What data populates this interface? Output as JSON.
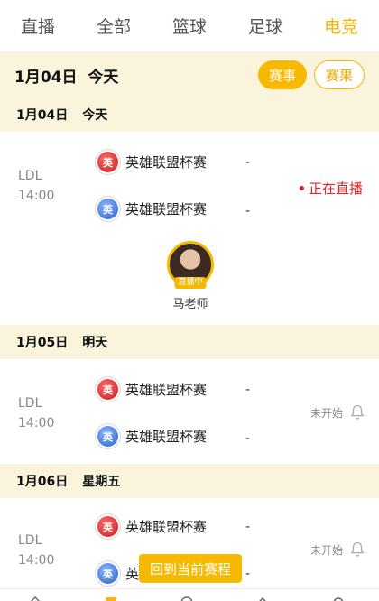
{
  "tabs": [
    "直播",
    "全部",
    "篮球",
    "足球",
    "电竞"
  ],
  "active_tab": "电竞",
  "header": {
    "date": "1月04日",
    "day": "今天",
    "filter_events": "赛事",
    "filter_results": "赛果"
  },
  "sections": [
    {
      "date": "1月04日",
      "day": "今天",
      "match": {
        "league": "LDL",
        "time": "14:00",
        "team1": "英雄联盟杯赛",
        "team2": "英雄联盟杯赛",
        "score1": "-",
        "score2": "-",
        "status": "正在直播"
      },
      "streamer": {
        "name": "马老师",
        "tag": "直播中"
      }
    },
    {
      "date": "1月05日",
      "day": "明天",
      "match": {
        "league": "LDL",
        "time": "14:00",
        "team1": "英雄联盟杯赛",
        "team2": "英雄联盟杯赛",
        "score1": "-",
        "score2": "-",
        "status": "未开始"
      }
    },
    {
      "date": "1月06日",
      "day": "星期五",
      "match": {
        "league": "LDL",
        "time": "14:00",
        "team1": "英雄联盟杯赛",
        "team2": "英",
        "score1": "-",
        "score2": "-",
        "status": "未开始"
      }
    }
  ],
  "badge_glyph": "英",
  "back_to_current": "回到当前赛程",
  "colors": {
    "accent": "#f7b800",
    "live": "#e0252b",
    "section_bg": "#fbf4dd"
  }
}
